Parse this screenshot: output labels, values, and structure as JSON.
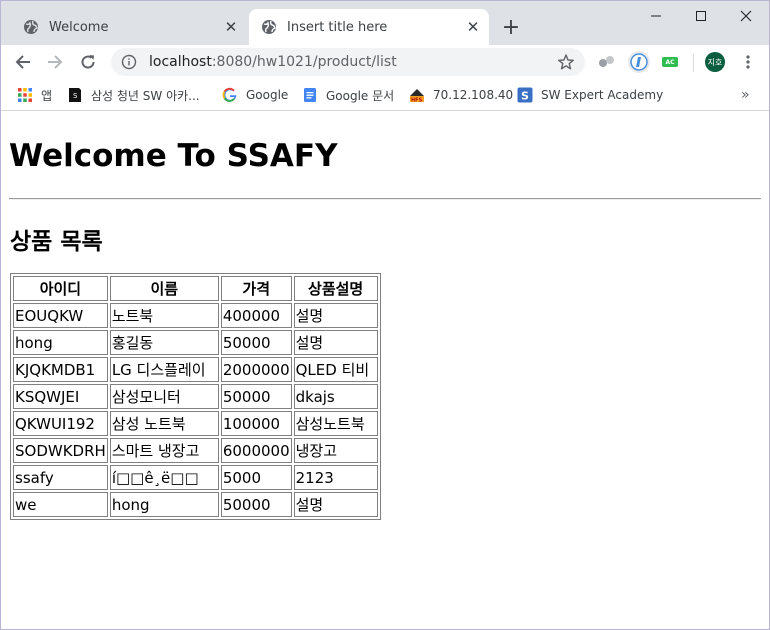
{
  "browser": {
    "tabs": [
      {
        "title": "Welcome",
        "active": false
      },
      {
        "title": "Insert title here",
        "active": true
      }
    ],
    "new_tab_label": "+",
    "url_host": "localhost",
    "url_rest": ":8080/hw1021/product/list",
    "profile_initials": "지호",
    "ext_badge": "AC"
  },
  "bookmarks": [
    {
      "label": "앱",
      "icon": "apps-grid-icon"
    },
    {
      "label": "삼성 청년 SW 아카...",
      "icon": "ssafy-icon"
    },
    {
      "label": "Google",
      "icon": "google-icon"
    },
    {
      "label": "Google 문서",
      "icon": "google-docs-icon"
    },
    {
      "label": "70.12.108.40",
      "icon": "hfs-icon"
    },
    {
      "label": "SW Expert Academy",
      "icon": "swea-icon"
    }
  ],
  "page": {
    "heading": "Welcome To SSAFY",
    "list_title": "상품 목록",
    "table": {
      "headers": [
        "아이디",
        "이름",
        "가격",
        "상품설명"
      ],
      "rows": [
        [
          "EOUQKW",
          "노트북",
          "400000",
          "설명"
        ],
        [
          "hong",
          "홍길동",
          "50000",
          "설명"
        ],
        [
          "KJQKMDB1",
          "LG 디스플레이",
          "2000000",
          "QLED 티비"
        ],
        [
          "KSQWJEI",
          "삼성모니터",
          "50000",
          "dkajs"
        ],
        [
          "QKWUI192",
          "삼성 노트북",
          "100000",
          "삼성노트북"
        ],
        [
          "SODWKDRH",
          "스마트 냉장고",
          "6000000",
          "냉장고"
        ],
        [
          "ssafy",
          "í□□ê¸ë□□",
          "5000",
          "2123"
        ],
        [
          "we",
          "hong",
          "50000",
          "설명"
        ]
      ]
    }
  }
}
